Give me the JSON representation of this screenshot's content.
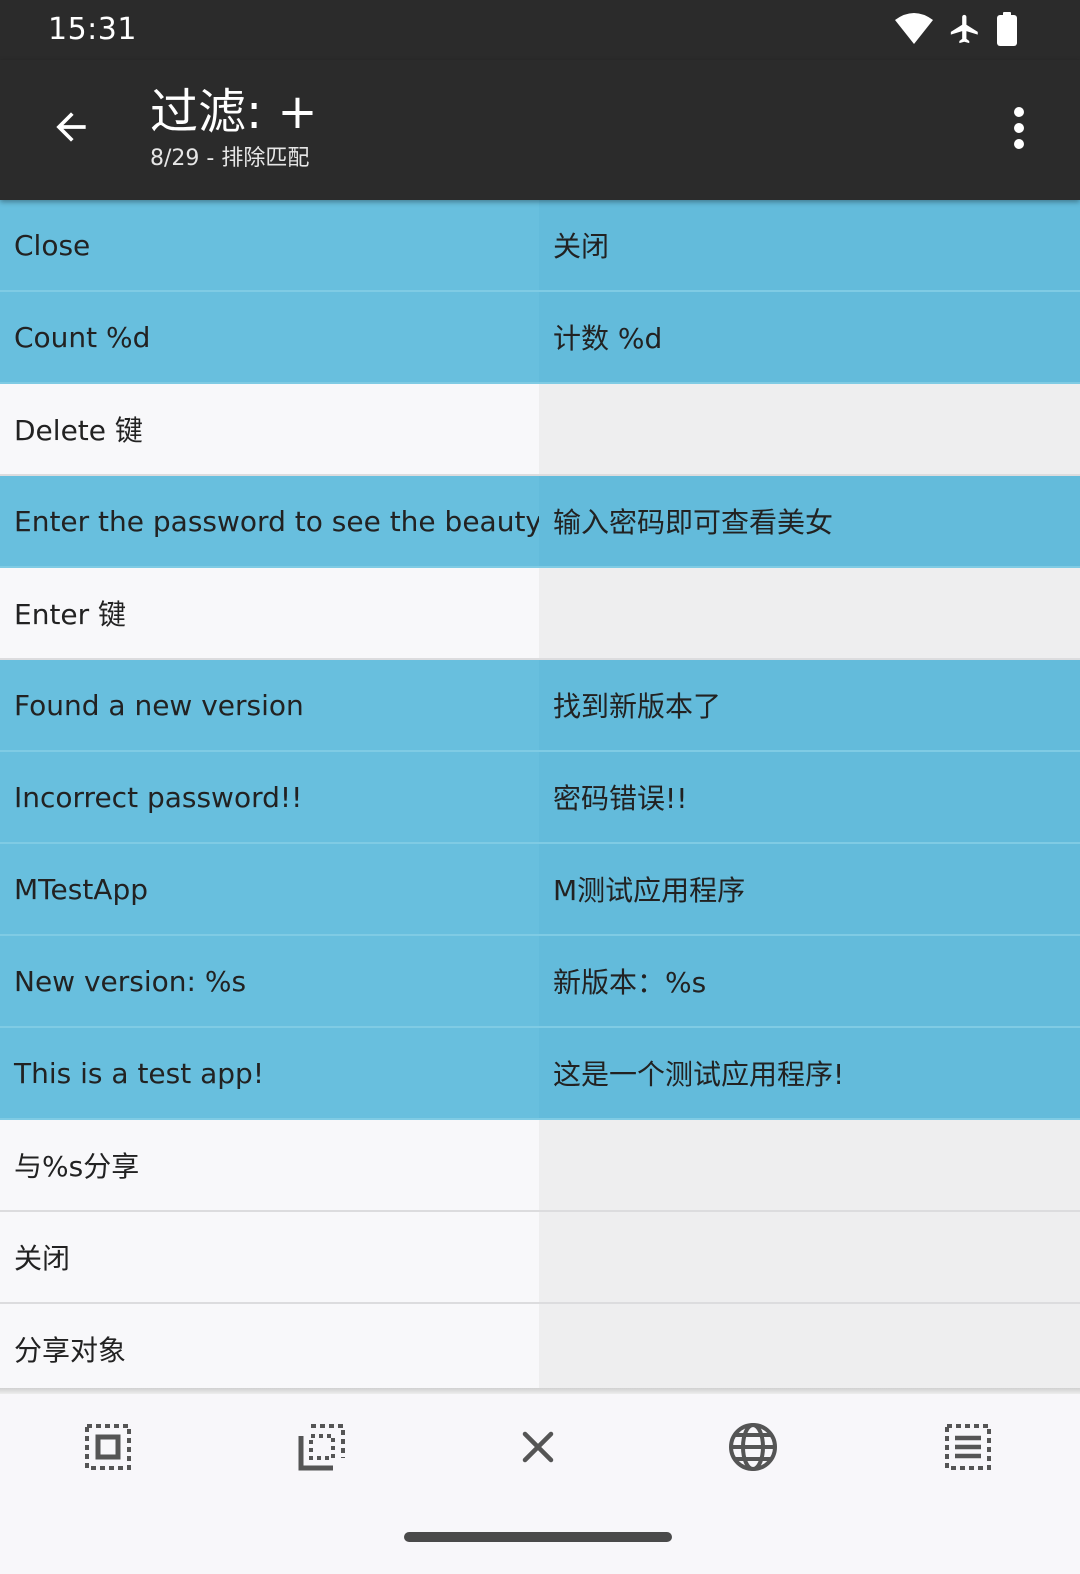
{
  "status": {
    "time": "15:31"
  },
  "appbar": {
    "title": "过滤: +",
    "subtitle": "8/29 - 排除匹配"
  },
  "rows": [
    {
      "source": "Close",
      "target": "关闭",
      "state": "done"
    },
    {
      "source": "Count %d",
      "target": "计数 %d",
      "state": "done"
    },
    {
      "source": "Delete 键",
      "target": "",
      "state": "pending"
    },
    {
      "source": "Enter the password to see the beauty",
      "target": "输入密码即可查看美女",
      "state": "done"
    },
    {
      "source": "Enter 键",
      "target": "",
      "state": "pending"
    },
    {
      "source": "Found a new version",
      "target": "找到新版本了",
      "state": "done"
    },
    {
      "source": "Incorrect password!!",
      "target": "密码错误!!",
      "state": "done"
    },
    {
      "source": "MTestApp",
      "target": "M测试应用程序",
      "state": "done"
    },
    {
      "source": "New version: %s",
      "target": "新版本：%s",
      "state": "done"
    },
    {
      "source": "This is a test app!",
      "target": "这是一个测试应用程序!",
      "state": "done"
    },
    {
      "source": "与%s分享",
      "target": "",
      "state": "pending"
    },
    {
      "source": "关闭",
      "target": "",
      "state": "pending"
    },
    {
      "source": "分享对象",
      "target": "",
      "state": "pending"
    }
  ],
  "colors": {
    "appbar": "#2B2B2B",
    "translated_row": "#68BFDE",
    "untranslated_left": "#F8F8FA",
    "untranslated_right": "#EEEEEF"
  },
  "icons": {
    "back": "arrow-left",
    "more": "dots-vertical",
    "toolbar": [
      "select-all",
      "select-inverse",
      "clear",
      "translate-globe",
      "select-list"
    ]
  }
}
